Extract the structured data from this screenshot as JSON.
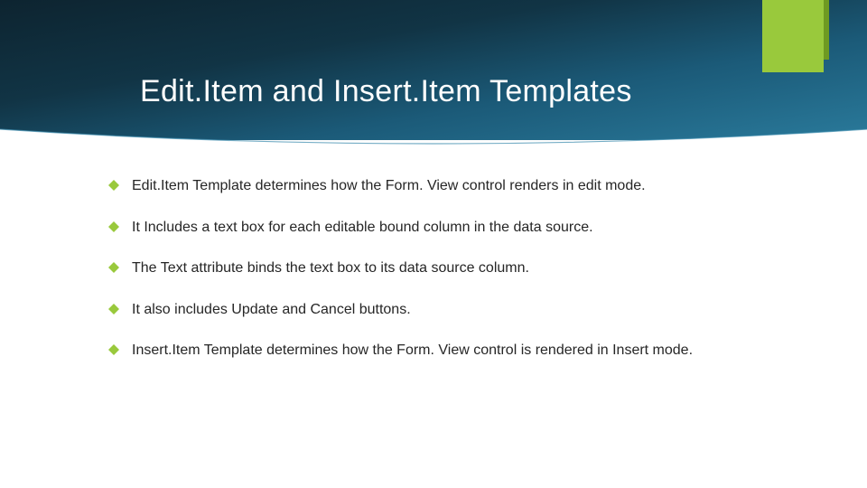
{
  "colors": {
    "accent_green": "#99c93c",
    "header_gradient_start": "#0d2430",
    "header_gradient_end": "#2a7a9b",
    "text": "#262626",
    "title": "#ffffff"
  },
  "title": "Edit.Item and Insert.Item Templates",
  "bullets": [
    "Edit.Item Template determines how the Form. View control renders in edit mode.",
    "It Includes a text box for each editable bound column in the data source.",
    "The Text attribute binds the text box to its data source column.",
    "It also includes  Update and Cancel buttons.",
    "Insert.Item Template determines how the  Form. View control  is rendered in Insert mode."
  ]
}
